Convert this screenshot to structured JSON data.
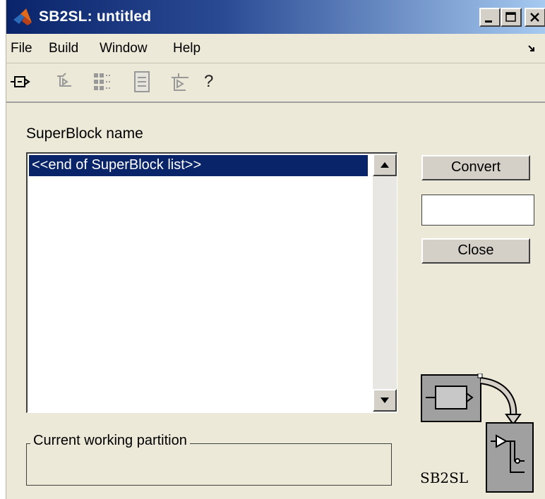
{
  "window": {
    "title": "SB2SL: untitled",
    "controls": [
      "minimize",
      "maximize",
      "close"
    ]
  },
  "menubar": {
    "items": [
      "File",
      "Build",
      "Window",
      "Help"
    ]
  },
  "toolbar": {
    "icons": [
      "component-icon",
      "build-icon",
      "grid-icon",
      "document-icon",
      "partition-icon"
    ],
    "help_label": "?"
  },
  "superblock": {
    "label": "SuperBlock name",
    "list": [
      "<<end of SuperBlock list>>"
    ],
    "selected_index": 0
  },
  "actions": {
    "convert_label": "Convert",
    "status_value": "",
    "close_label": "Close"
  },
  "partition": {
    "label": "Current working partition",
    "value": ""
  },
  "logo": {
    "text": "SB2SL"
  }
}
